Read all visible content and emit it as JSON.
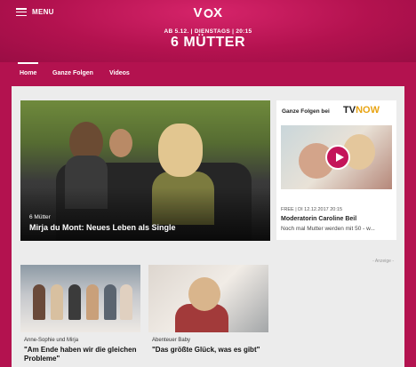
{
  "header": {
    "menu_label": "MENU",
    "logo_text": "VOX",
    "schedule": "AB 5.12. | DIENSTAGS | 20:15",
    "show_title": "6 MÜTTER"
  },
  "nav": {
    "items": [
      {
        "label": "Home",
        "active": true
      },
      {
        "label": "Ganze Folgen",
        "active": false
      },
      {
        "label": "Videos",
        "active": false
      }
    ]
  },
  "hero": {
    "kicker": "6 Mütter",
    "title": "Mirja du Mont: Neues Leben als Single"
  },
  "tvnow": {
    "label": "Ganze Folgen bei",
    "logo_tv": "TV",
    "logo_now": "NOW",
    "meta": "FREE | DI 12.12.2017 20:15",
    "title": "Moderatorin Caroline Beil",
    "description": "Noch mal Mutter werden mit 50 - w..."
  },
  "ad_label": "- Anzeige -",
  "cards": [
    {
      "kicker": "Anne-Sophie und Mirja",
      "title": "\"Am Ende haben wir die gleichen Probleme\""
    },
    {
      "kicker": "Abenteuer Baby",
      "title": "\"Das größte Glück, was es gibt\""
    }
  ],
  "colors": {
    "brand": "#b3124f",
    "play_button": "#c4155a",
    "now_accent": "#e8a413"
  }
}
